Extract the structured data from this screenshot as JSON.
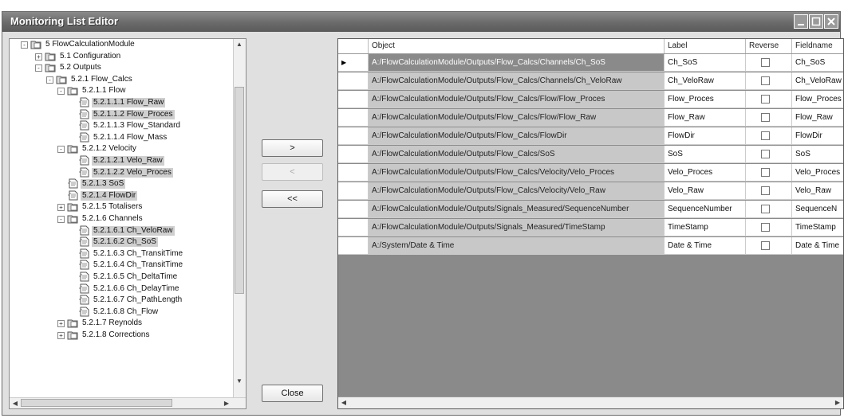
{
  "window": {
    "title": "Monitoring List Editor"
  },
  "tree": {
    "nodes": [
      {
        "label": "5 FlowCalculationModule",
        "expander": "-"
      },
      {
        "label": "5.1 Configuration",
        "expander": "+"
      },
      {
        "label": "5.2 Outputs",
        "expander": "-"
      },
      {
        "label": "5.2.1 Flow_Calcs",
        "expander": "-"
      },
      {
        "label": "5.2.1.1 Flow",
        "expander": "-"
      },
      {
        "label": "5.2.1.1.1 Flow_Raw",
        "selected": true
      },
      {
        "label": "5.2.1.1.2 Flow_Proces",
        "selected": true
      },
      {
        "label": "5.2.1.1.3 Flow_Standard"
      },
      {
        "label": "5.2.1.1.4 Flow_Mass"
      },
      {
        "label": "5.2.1.2 Velocity",
        "expander": "-"
      },
      {
        "label": "5.2.1.2.1 Velo_Raw",
        "selected": true
      },
      {
        "label": "5.2.1.2.2 Velo_Proces",
        "selected": true
      },
      {
        "label": "5.2.1.3 SoS",
        "selected": true
      },
      {
        "label": "5.2.1.4 FlowDir",
        "selected": true
      },
      {
        "label": "5.2.1.5 Totalisers",
        "expander": "+"
      },
      {
        "label": "5.2.1.6 Channels",
        "expander": "-"
      },
      {
        "label": "5.2.1.6.1 Ch_VeloRaw",
        "selected": true
      },
      {
        "label": "5.2.1.6.2 Ch_SoS",
        "selected": true
      },
      {
        "label": "5.2.1.6.3 Ch_TransitTime"
      },
      {
        "label": "5.2.1.6.4 Ch_TransitTime"
      },
      {
        "label": "5.2.1.6.5 Ch_DeltaTime"
      },
      {
        "label": "5.2.1.6.6 Ch_DelayTime"
      },
      {
        "label": "5.2.1.6.7 Ch_PathLength"
      },
      {
        "label": "5.2.1.6.8 Ch_Flow"
      },
      {
        "label": "5.2.1.7 Reynolds",
        "expander": "+"
      },
      {
        "label": "5.2.1.8 Corrections",
        "expander": "+"
      }
    ]
  },
  "buttons": {
    "add": ">",
    "remove": "<",
    "remove_all": "<<",
    "close": "Close"
  },
  "grid": {
    "headers": {
      "object": "Object",
      "label": "Label",
      "reverse": "Reverse",
      "fieldname": "Fieldname"
    },
    "rows": [
      {
        "object": "A:/FlowCalculationModule/Outputs/Flow_Calcs/Channels/Ch_SoS",
        "label": "Ch_SoS",
        "reverse": false,
        "fieldname": "Ch_SoS",
        "current": true
      },
      {
        "object": "A:/FlowCalculationModule/Outputs/Flow_Calcs/Channels/Ch_VeloRaw",
        "label": "Ch_VeloRaw",
        "reverse": false,
        "fieldname": "Ch_VeloRaw"
      },
      {
        "object": "A:/FlowCalculationModule/Outputs/Flow_Calcs/Flow/Flow_Proces",
        "label": "Flow_Proces",
        "reverse": false,
        "fieldname": "Flow_Proces"
      },
      {
        "object": "A:/FlowCalculationModule/Outputs/Flow_Calcs/Flow/Flow_Raw",
        "label": "Flow_Raw",
        "reverse": false,
        "fieldname": "Flow_Raw"
      },
      {
        "object": "A:/FlowCalculationModule/Outputs/Flow_Calcs/FlowDir",
        "label": "FlowDir",
        "reverse": false,
        "fieldname": "FlowDir"
      },
      {
        "object": "A:/FlowCalculationModule/Outputs/Flow_Calcs/SoS",
        "label": "SoS",
        "reverse": false,
        "fieldname": "SoS"
      },
      {
        "object": "A:/FlowCalculationModule/Outputs/Flow_Calcs/Velocity/Velo_Proces",
        "label": "Velo_Proces",
        "reverse": false,
        "fieldname": "Velo_Proces"
      },
      {
        "object": "A:/FlowCalculationModule/Outputs/Flow_Calcs/Velocity/Velo_Raw",
        "label": "Velo_Raw",
        "reverse": false,
        "fieldname": "Velo_Raw"
      },
      {
        "object": "A:/FlowCalculationModule/Outputs/Signals_Measured/SequenceNumber",
        "label": "SequenceNumber",
        "reverse": false,
        "fieldname": "SequenceN"
      },
      {
        "object": "A:/FlowCalculationModule/Outputs/Signals_Measured/TimeStamp",
        "label": "TimeStamp",
        "reverse": false,
        "fieldname": "TimeStamp"
      },
      {
        "object": "A:/System/Date & Time",
        "label": "Date & Time",
        "reverse": false,
        "fieldname": "Date & Time"
      }
    ]
  },
  "icons": {
    "tree_node": "folder-document-icon",
    "tree_leaf": "document-icon",
    "minimize": "minimize-icon",
    "maximize": "maximize-icon",
    "close": "close-icon"
  }
}
